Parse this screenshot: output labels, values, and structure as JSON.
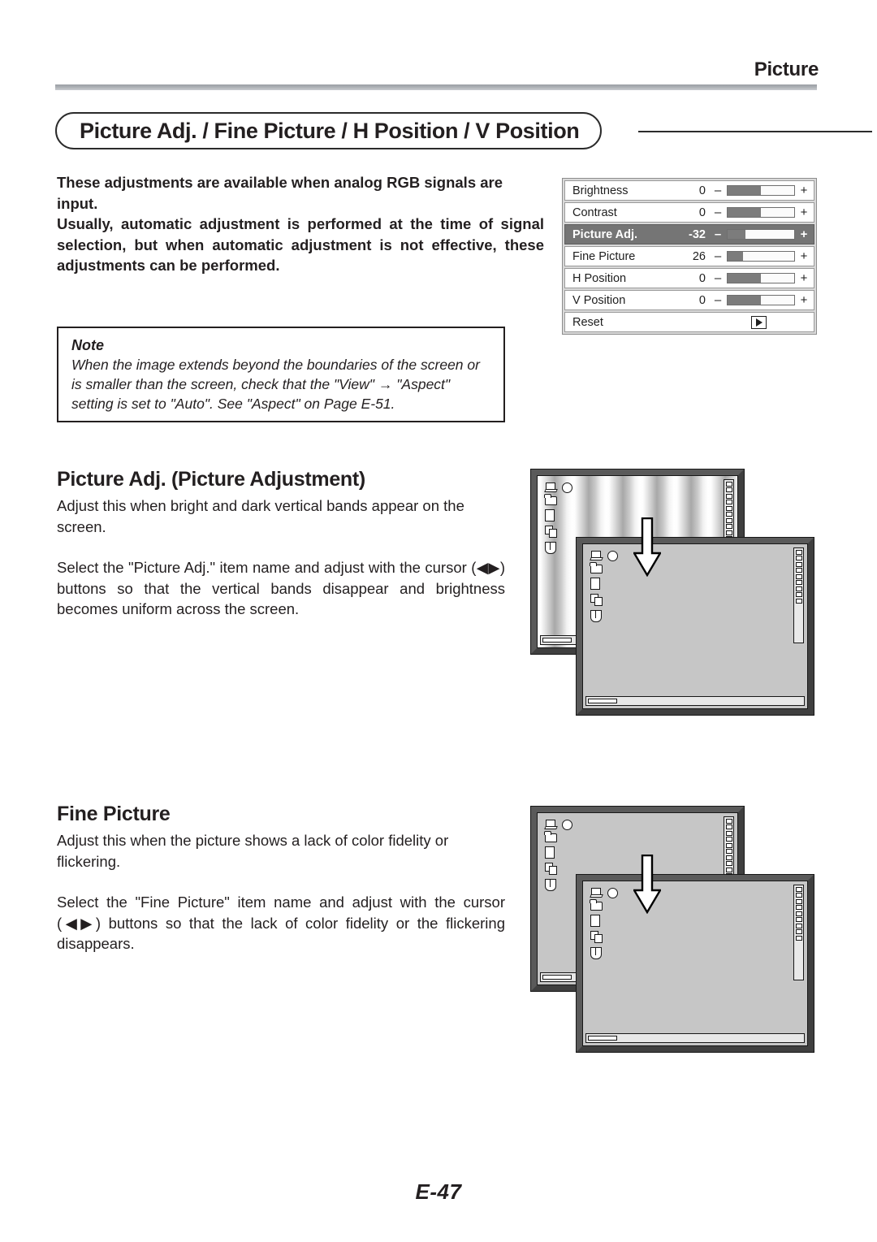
{
  "header": {
    "chapter": "Picture",
    "section_title": "Picture Adj. / Fine Picture / H Position / V Position"
  },
  "intro": {
    "paragraph_1": "These adjustments are available when analog RGB signals are input.",
    "paragraph_2": "Usually, automatic adjustment is performed at the time of signal selection, but when automatic adjustment is not effective, these adjustments can be performed."
  },
  "note": {
    "title": "Note",
    "body": "When the image extends beyond the boundaries of the screen or is smaller than the screen, check that the \"View\" → \"Aspect\" setting is set to \"Auto\". See \"Aspect\" on Page E-51."
  },
  "osd_menu": {
    "rows": [
      {
        "label": "Brightness",
        "value": "0",
        "fill_pct": 50,
        "selected": false,
        "type": "slider",
        "minus": "–",
        "plus": "+"
      },
      {
        "label": "Contrast",
        "value": "0",
        "fill_pct": 50,
        "selected": false,
        "type": "slider",
        "minus": "–",
        "plus": "+"
      },
      {
        "label": "Picture Adj.",
        "value": "-32",
        "fill_pct": 27,
        "selected": true,
        "type": "slider",
        "minus": "–",
        "plus": "+"
      },
      {
        "label": "Fine Picture",
        "value": "26",
        "fill_pct": 23,
        "selected": false,
        "type": "slider",
        "minus": "–",
        "plus": "+"
      },
      {
        "label": "H Position",
        "value": "0",
        "fill_pct": 50,
        "selected": false,
        "type": "slider",
        "minus": "–",
        "plus": "+"
      },
      {
        "label": "V Position",
        "value": "0",
        "fill_pct": 50,
        "selected": false,
        "type": "slider",
        "minus": "–",
        "plus": "+"
      },
      {
        "label": "Reset",
        "value": "",
        "fill_pct": 0,
        "selected": false,
        "type": "button",
        "minus": "",
        "plus": ""
      }
    ],
    "selected_color": "#757575",
    "slider_fill_color": "#7c7c7c"
  },
  "sections": [
    {
      "heading": "Picture Adj. (Picture Adjustment)",
      "paragraph_1": "Adjust this when bright and dark vertical bands appear on the screen.",
      "paragraph_2": "Select the \"Picture Adj.\" item name and adjust with the cursor (◀▶) buttons so that the vertical bands disappear and brightness becomes uniform across the screen."
    },
    {
      "heading": "Fine Picture",
      "paragraph_1": "Adjust this when the picture shows a lack of color fidelity or flickering.",
      "paragraph_2": "Select the \"Fine Picture\" item name and adjust with the cursor (◀▶) buttons so that the lack of color fidelity or the flickering disappears."
    }
  ],
  "illustrations": [
    {
      "before_state": "vertical-bands",
      "after_state": "uniform",
      "arrow": "down-arrow"
    },
    {
      "before_state": "uniform",
      "after_state": "uniform",
      "arrow": "down-arrow"
    }
  ],
  "footer": {
    "page_number": "E-47"
  }
}
